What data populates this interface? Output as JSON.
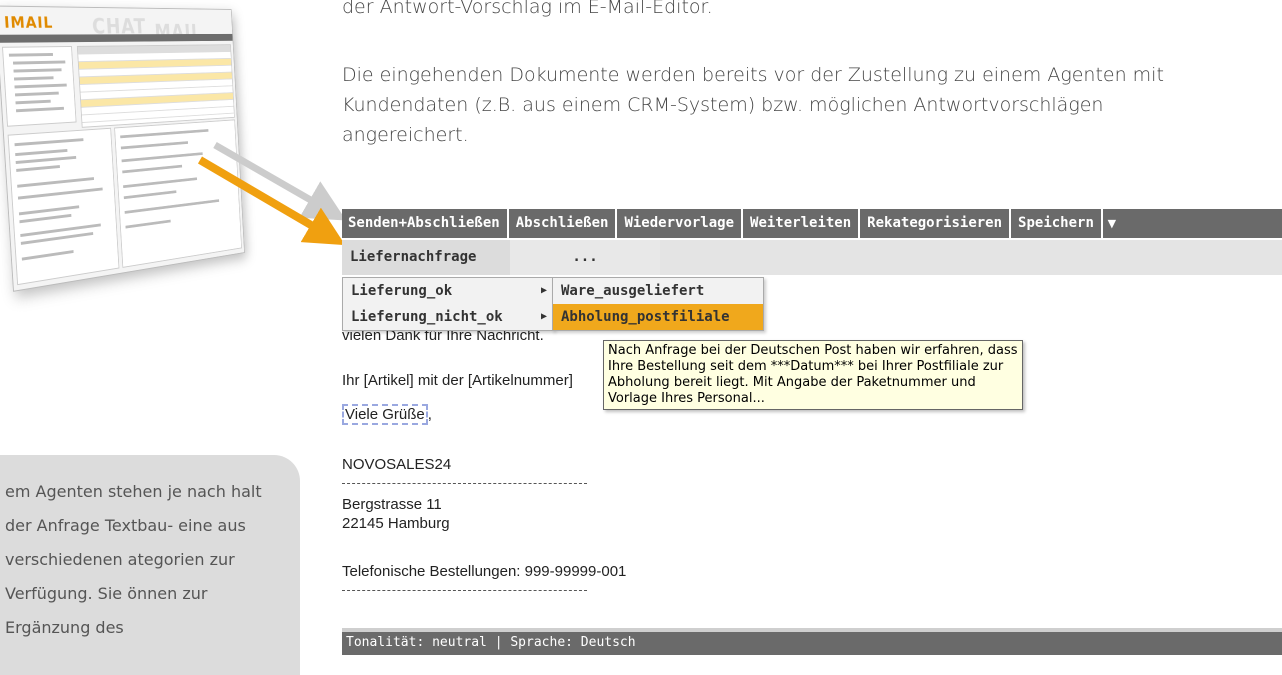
{
  "intro": {
    "line1": "der Antwort-Vorschlag im E-Mail-Editor.",
    "para2": "Die eingehenden Dokumente werden bereits vor der Zustellung zu einem Agenten mit Kundendaten (z.B. aus einem CRM-System) bzw. möglichen Antwortvorschlägen angereichert."
  },
  "thumbnail": {
    "logo_text": "IMAIL",
    "ghost1": "CHAT",
    "ghost2": "MAIL"
  },
  "note": {
    "text": "em Agenten stehen je nach halt der Anfrage Textbau- eine aus verschiedenen ategorien zur Verfügung. Sie önnen zur Ergänzung des"
  },
  "toolbar": {
    "buttons": [
      "Senden+Abschließen",
      "Abschließen",
      "Wiedervorlage",
      "Weiterleiten",
      "Rekategorisieren",
      "Speichern"
    ],
    "more_icon": "caret-down-icon"
  },
  "categories": {
    "primary": "Liefernachfrage",
    "secondary": "..."
  },
  "menu_level1": [
    {
      "label": "Lieferung_ok"
    },
    {
      "label": "Lieferung_nicht_ok"
    }
  ],
  "menu_level2": [
    {
      "label": "Ware_ausgeliefert",
      "active": false
    },
    {
      "label": "Abholung_postfiliale",
      "active": true
    }
  ],
  "tooltip": {
    "text": "Nach Anfrage bei der Deutschen Post haben wir erfahren, dass Ihre Bestellung seit dem ***Datum*** bei Ihrer Postfiliale zur Abholung bereit liegt. Mit Angabe der Paketnummer und Vorlage Ihres Personal..."
  },
  "body": {
    "line1": "vielen Dank für Ihre Nachricht.",
    "line2": "Ihr [Artikel] mit der [Artikelnummer]",
    "greeting": "Viele Grüße",
    "greeting_comma": ",",
    "company": "NOVOSALES24",
    "street": "Bergstrasse 11",
    "city": "22145 Hamburg",
    "phone": "Telefonische Bestellungen: 999-99999-001"
  },
  "status": {
    "text": "Tonalität: neutral | Sprache: Deutsch"
  },
  "colors": {
    "toolbar_bg": "#6a6a6a",
    "menu_highlight": "#f0a81c",
    "arrow_orange": "#f0a010",
    "arrow_gray": "#cccccc",
    "tooltip_bg": "#ffffe1"
  }
}
